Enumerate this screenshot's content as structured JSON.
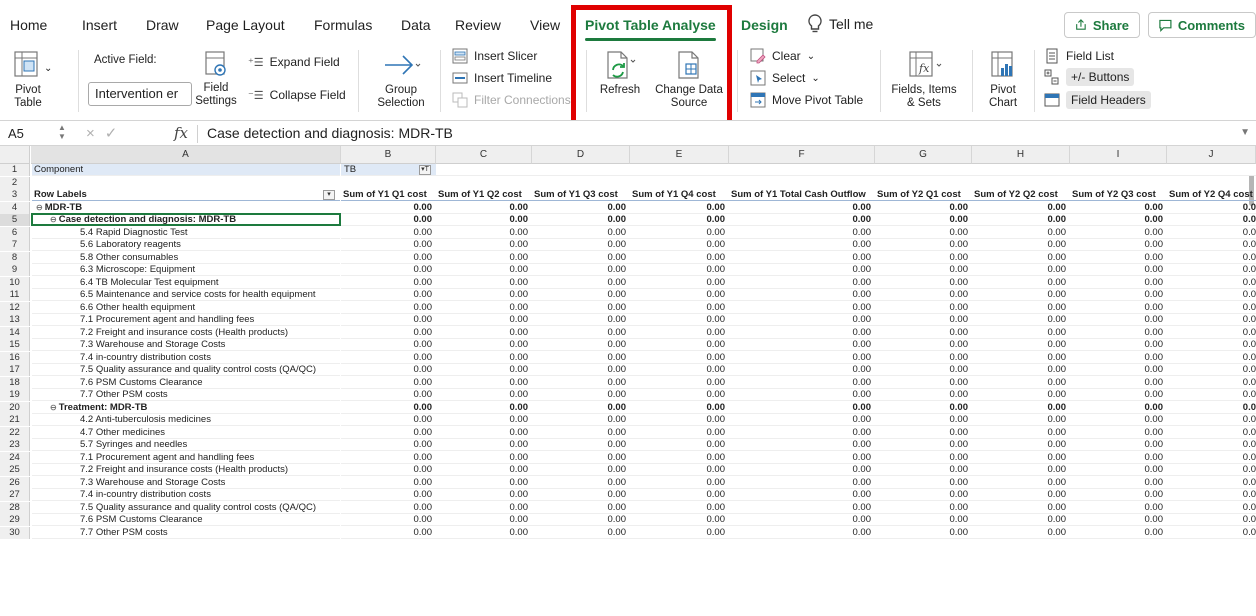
{
  "tabs": [
    "Home",
    "Insert",
    "Draw",
    "Page Layout",
    "Formulas",
    "Data",
    "Review",
    "View",
    "Pivot Table Analyse",
    "Design"
  ],
  "tell_me": "Tell me",
  "share_label": "Share",
  "comments_label": "Comments",
  "ribbon": {
    "pivot_table": "Pivot Table",
    "active_field_label": "Active Field:",
    "active_field_value": "Intervention er",
    "field_settings": "Field Settings",
    "expand_field": "Expand Field",
    "collapse_field": "Collapse Field",
    "group_selection": "Group Selection",
    "insert_slicer": "Insert Slicer",
    "insert_timeline": "Insert Timeline",
    "filter_connections": "Filter Connections",
    "refresh": "Refresh",
    "change_data_source": "Change Data Source",
    "clear": "Clear",
    "select": "Select",
    "move_pivot_table": "Move Pivot Table",
    "fields_items_sets": "Fields, Items & Sets",
    "pivot_chart": "Pivot Chart",
    "field_list": "Field List",
    "plus_minus_buttons": "+/- Buttons",
    "field_headers": "Field Headers"
  },
  "formula_bar": {
    "cell_ref": "A5",
    "formula": "Case detection and diagnosis: MDR-TB"
  },
  "columns": [
    "A",
    "B",
    "C",
    "D",
    "E",
    "F",
    "G",
    "H",
    "I",
    "J"
  ],
  "filter_row": {
    "label": "Component",
    "value": "TB"
  },
  "header_row": {
    "label": "Row Labels",
    "values": [
      "Sum of Y1 Q1 cost",
      "Sum of Y1 Q2 cost",
      "Sum of Y1 Q3 cost",
      "Sum of Y1 Q4 cost",
      "Sum of Y1 Total Cash Outflow",
      "Sum of Y2 Q1 cost",
      "Sum of Y2 Q2 cost",
      "Sum of Y2 Q3 cost",
      "Sum of Y2 Q4 cost"
    ]
  },
  "rows": [
    {
      "n": "4",
      "label": "MDR-TB",
      "level": 0,
      "bold": true,
      "collapse": true
    },
    {
      "n": "5",
      "label": "Case detection and diagnosis: MDR-TB",
      "level": 1,
      "bold": true,
      "collapse": true
    },
    {
      "n": "6",
      "label": "5.4 Rapid Diagnostic Test",
      "level": 2
    },
    {
      "n": "7",
      "label": "5.6 Laboratory reagents",
      "level": 2
    },
    {
      "n": "8",
      "label": "5.8 Other consumables",
      "level": 2
    },
    {
      "n": "9",
      "label": "6.3 Microscope: Equipment",
      "level": 2
    },
    {
      "n": "10",
      "label": "6.4 TB Molecular Test equipment",
      "level": 2
    },
    {
      "n": "11",
      "label": "6.5 Maintenance and service costs for health equipment",
      "level": 2
    },
    {
      "n": "12",
      "label": "6.6 Other health equipment",
      "level": 2
    },
    {
      "n": "13",
      "label": "7.1 Procurement agent and handling fees",
      "level": 2
    },
    {
      "n": "14",
      "label": "7.2 Freight and insurance costs (Health products)",
      "level": 2
    },
    {
      "n": "15",
      "label": "7.3 Warehouse and Storage Costs",
      "level": 2
    },
    {
      "n": "16",
      "label": "7.4 in-country distribution costs",
      "level": 2
    },
    {
      "n": "17",
      "label": "7.5 Quality assurance and quality control costs (QA/QC)",
      "level": 2
    },
    {
      "n": "18",
      "label": "7.6 PSM Customs Clearance",
      "level": 2
    },
    {
      "n": "19",
      "label": "7.7 Other PSM costs",
      "level": 2
    },
    {
      "n": "20",
      "label": "Treatment: MDR-TB",
      "level": 1,
      "bold": true,
      "collapse": true
    },
    {
      "n": "21",
      "label": "4.2 Anti-tuberculosis medicines",
      "level": 2
    },
    {
      "n": "22",
      "label": "4.7 Other medicines",
      "level": 2
    },
    {
      "n": "23",
      "label": "5.7 Syringes and needles",
      "level": 2
    },
    {
      "n": "24",
      "label": "7.1 Procurement agent and handling fees",
      "level": 2
    },
    {
      "n": "25",
      "label": "7.2 Freight and insurance costs (Health products)",
      "level": 2
    },
    {
      "n": "26",
      "label": "7.3 Warehouse and Storage Costs",
      "level": 2
    },
    {
      "n": "27",
      "label": "7.4 in-country distribution costs",
      "level": 2
    },
    {
      "n": "28",
      "label": "7.5 Quality assurance and quality control costs (QA/QC)",
      "level": 2
    },
    {
      "n": "29",
      "label": "7.6 PSM Customs Clearance",
      "level": 2
    },
    {
      "n": "30",
      "label": "7.7 Other PSM costs",
      "level": 2
    }
  ],
  "cell_value": "0.00",
  "last_col_clip": "0.0",
  "accent": "#1d7a3e",
  "highlight_box_color": "#e00000"
}
